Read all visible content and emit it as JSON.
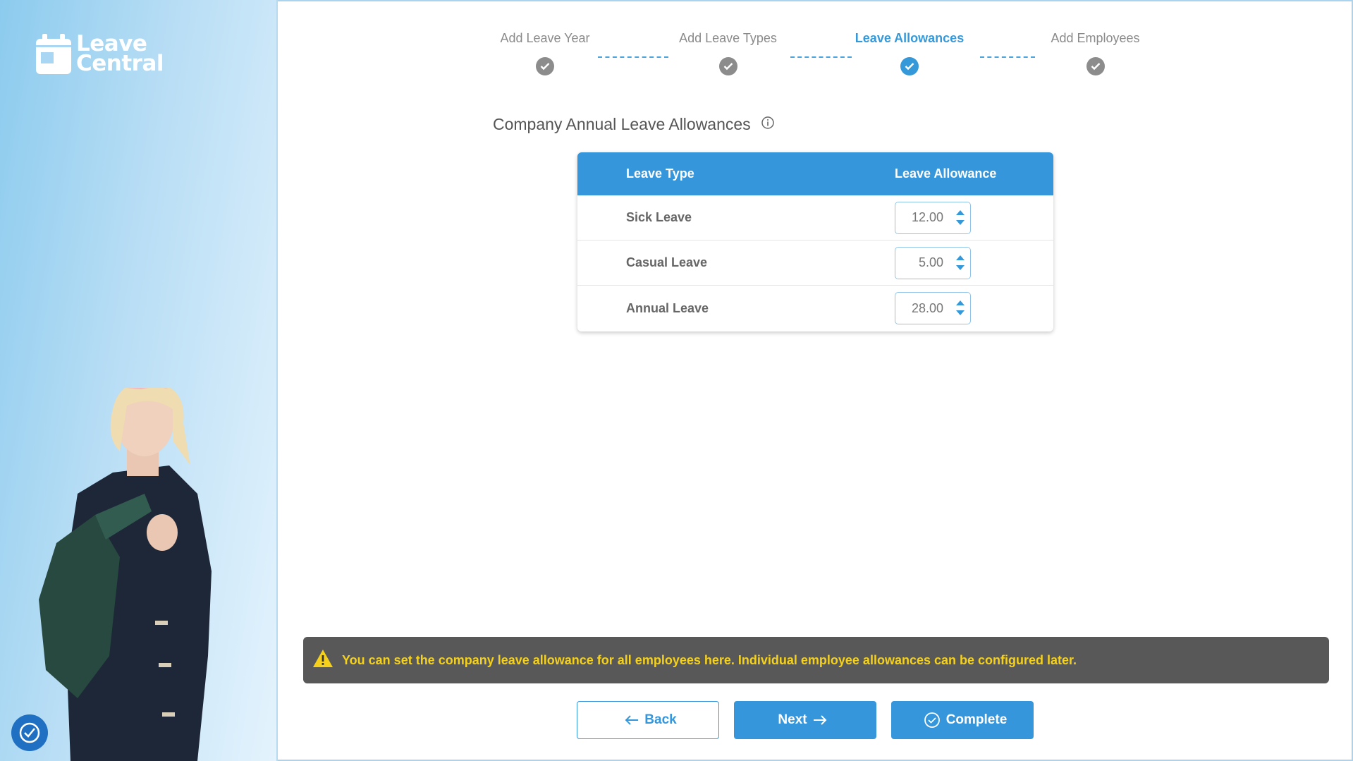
{
  "brand": {
    "name_line1": "Leave",
    "name_line2": "Central",
    "accent": "#3596dc"
  },
  "stepper": {
    "steps": [
      {
        "label": "Add Leave Year",
        "state": "complete"
      },
      {
        "label": "Add Leave Types",
        "state": "complete"
      },
      {
        "label": "Leave Allowances",
        "state": "active"
      },
      {
        "label": "Add Employees",
        "state": "complete"
      }
    ]
  },
  "section": {
    "title": "Company Annual Leave Allowances",
    "info_icon": "info-icon"
  },
  "table": {
    "headers": [
      "Leave Type",
      "Leave Allowance"
    ],
    "rows": [
      {
        "type": "Sick Leave",
        "allowance": "12.00"
      },
      {
        "type": "Casual Leave",
        "allowance": "5.00"
      },
      {
        "type": "Annual Leave",
        "allowance": "28.00"
      }
    ]
  },
  "warning": {
    "icon": "warning-triangle-icon",
    "text": "You can set the company leave allowance for all employees here. Individual employee allowances can be configured later.",
    "text_color": "#f5d11b"
  },
  "actions": {
    "back_label": "Back",
    "next_label": "Next",
    "complete_label": "Complete"
  }
}
